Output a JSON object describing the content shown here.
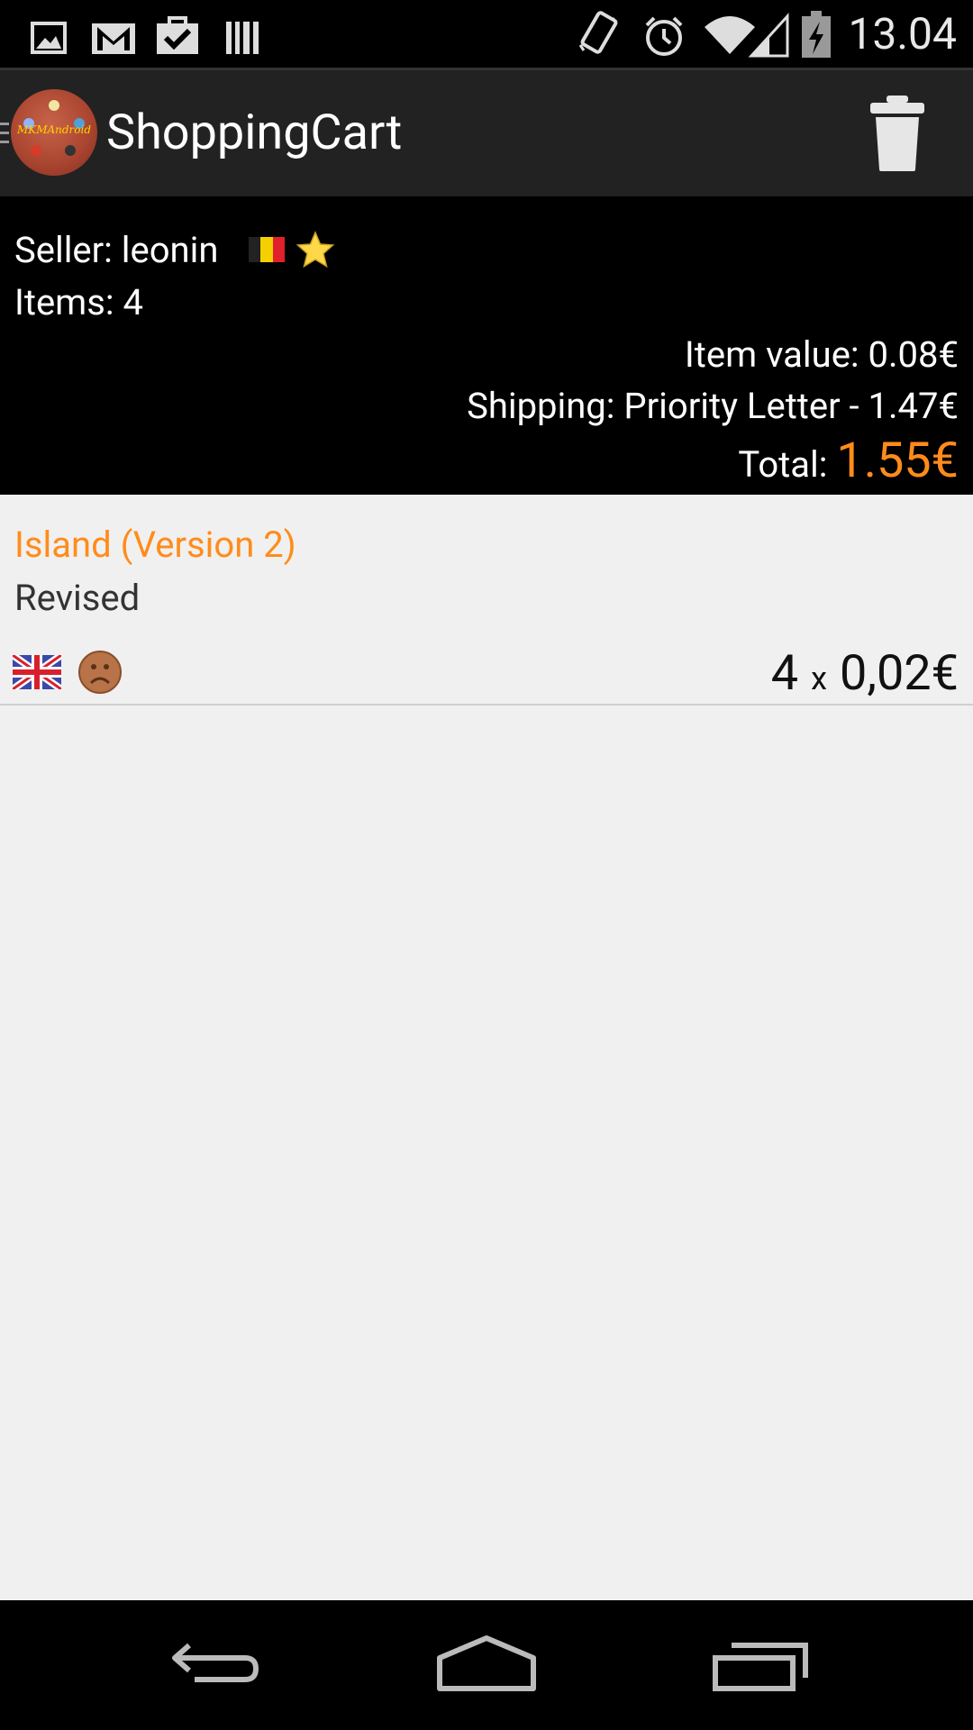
{
  "status_bar": {
    "time": "13.04",
    "left_icons": [
      "picture-icon",
      "gmail-icon",
      "bag-check-icon",
      "barcode-icon"
    ],
    "right_icons": [
      "vibrate-icon",
      "alarm-icon",
      "wifi-icon",
      "signal-icon",
      "battery-charging-icon"
    ]
  },
  "action_bar": {
    "logo_text": "MKMAndroid",
    "title": "ShoppingCart",
    "actions": [
      "trash-icon"
    ]
  },
  "summary": {
    "seller_label": "Seller:",
    "seller_name": "leonin",
    "seller_country_icon": "belgium-flag-icon",
    "seller_rating_icon": "star-icon",
    "items_label": "Items:",
    "items_count": "4",
    "item_value_label": "Item value:",
    "item_value": "0.08€",
    "shipping_label": "Shipping:",
    "shipping_value": "Priority Letter - 1.47€",
    "total_label": "Total:",
    "total_value": "1.55€",
    "accent_color": "#ff8c1a"
  },
  "cart_items": [
    {
      "name": "Island (Version 2)",
      "expansion": "Revised",
      "language_icon": "uk-flag-icon",
      "condition_icon": "sad-face-icon",
      "quantity": "4",
      "times": "x",
      "price": "0,02€"
    }
  ],
  "nav_bar": [
    "back-icon",
    "home-icon",
    "recents-icon"
  ]
}
